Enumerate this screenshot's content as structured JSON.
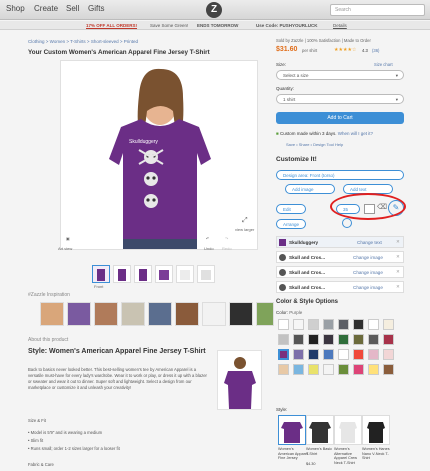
{
  "nav": {
    "shop": "Shop",
    "create": "Create",
    "sell": "Sell",
    "gifts": "Gifts",
    "logo": "Z",
    "search_placeholder": "Search"
  },
  "promo": {
    "p1": "17% OFF ALL ORDERS!",
    "p2": "Save Some Green!",
    "p3": "ENDS TOMORROW",
    "p4": "Use Code: PUSHYOURLUCK",
    "p5": "Details"
  },
  "breadcrumb": {
    "b1": "Clothing",
    "b2": "Women",
    "b3": "T-Shirts",
    "b4": "Short-sleeved",
    "b5": "Printed"
  },
  "product_title": "Your Custom Women's American Apparel Fine Jersey T-Shirt",
  "tools": {
    "art_view": "Art view",
    "undo": "Undo",
    "redo": "Redo",
    "view_larger": "view larger",
    "front": "Front"
  },
  "inspiration": "#Zazzle Inspiration",
  "about": {
    "heading": "About this product",
    "style_title": "Style: Women's American Apparel Fine Jersey T-Shirt",
    "description": "Back to basics never looked better. This best-selling women's tee by American Apparel is a versatile must-have for every lady's wardrobe. Wear it to work or play, or dress it up with a blazer or sweater and wear it out to dinner. Super soft and lightweight. Select a design from our marketplace or customize it and unleash your creativity!",
    "size_fit": "Size & Fit",
    "fit1": "Model is 5'9\" and is wearing a medium",
    "fit2": "Slim fit",
    "fit3": "Runs small; order 1-2 sizes larger for a looser fit",
    "fabric": "Fabric & Care"
  },
  "sold_by": "Sold by Zazzle",
  "satisfaction": "100% Satisfaction",
  "made_in": "Made to Order",
  "price": "$31.60",
  "price_per": "per shirt",
  "rating": "4.3",
  "reviews": "(36)",
  "size": {
    "label": "Size:",
    "guide": "Size chart",
    "value": "Select a size"
  },
  "quantity": {
    "label": "Quantity:",
    "value": "1 shirt"
  },
  "cart": "Add to Cart",
  "ship_text": "Custom made within 3 days.",
  "ship_link": "When will I get it?",
  "save_links": {
    "l1": "Save",
    "l2": "Share",
    "l3": "Design Tool Help"
  },
  "customize": {
    "title": "Customize It!",
    "design_area": "Design area: Front (torso)",
    "add_image": "Add image",
    "add_text": "Add text",
    "edit": "Edit",
    "font_size": "35",
    "arrange": "Arrange"
  },
  "layers": [
    {
      "name": "Skullduggery",
      "action": "Change text"
    },
    {
      "name": "Skull and Cros...",
      "action": "Change image"
    },
    {
      "name": "Skull and Cros...",
      "action": "Change image"
    },
    {
      "name": "Skull and Cros...",
      "action": "Change image"
    }
  ],
  "color_style": {
    "title": "Color & Style Options",
    "color_label": "Color:",
    "color_value": "Purple"
  },
  "swatches": [
    "#ffffff",
    "#f6f6f6",
    "#cfcfcf",
    "#9aa0a6",
    "#5c5f66",
    "#303030",
    "#ffffff",
    "#f5eedf",
    "#c2c2c2",
    "#555555",
    "#222222",
    "#3b3540",
    "#2f6d3a",
    "#6b6a3b",
    "#5a5a5a",
    "#a7324a",
    "#7b2f7d",
    "#7c6faa",
    "#1f3a6a",
    "#4d79bd",
    "#ffffff",
    "#f04a3b",
    "#e4b7c8",
    "#f2d6d6",
    "#e8c9a6",
    "#7ab6e0",
    "#e9e26b",
    "#f4f4f4",
    "#6a8e3a",
    "#dd4477",
    "#ffe17a",
    "#8a5d3b"
  ],
  "style_label": "Style:",
  "styles": [
    {
      "name": "Women's American Apparel Fine Jersey",
      "price": ""
    },
    {
      "name": "Women's Basic T-Shirt",
      "price": "$4.30"
    },
    {
      "name": "Women's Alternative Apparel Crew Neck T-Shirt",
      "price": ""
    },
    {
      "name": "Women's Hanes Nano V-Neck T-Shirt",
      "price": ""
    }
  ]
}
